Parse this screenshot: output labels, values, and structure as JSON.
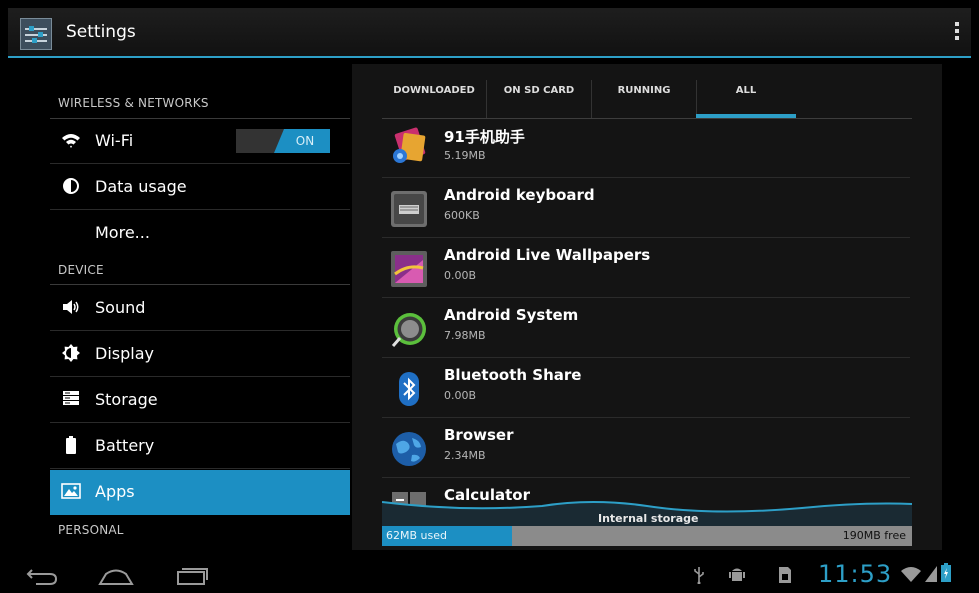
{
  "action_bar": {
    "title": "Settings"
  },
  "left_pane": {
    "sections": {
      "wireless": "WIRELESS & NETWORKS",
      "device": "DEVICE",
      "personal": "PERSONAL"
    },
    "items": [
      {
        "label": "Wi-Fi",
        "icon": "wifi-icon",
        "toggle": "ON"
      },
      {
        "label": "Data usage",
        "icon": "data-usage-icon"
      },
      {
        "label": "More..."
      },
      {
        "label": "Sound",
        "icon": "speaker-icon"
      },
      {
        "label": "Display",
        "icon": "brightness-icon"
      },
      {
        "label": "Storage",
        "icon": "storage-icon"
      },
      {
        "label": "Battery",
        "icon": "battery-icon"
      },
      {
        "label": "Apps",
        "icon": "apps-icon",
        "selected": true
      }
    ]
  },
  "tabs": [
    "DOWNLOADED",
    "ON SD CARD",
    "RUNNING",
    "ALL"
  ],
  "active_tab": "ALL",
  "apps": [
    {
      "name": "91手机助手",
      "size": "5.19MB"
    },
    {
      "name": "Android keyboard",
      "size": "600KB"
    },
    {
      "name": "Android Live Wallpapers",
      "size": "0.00B"
    },
    {
      "name": "Android System",
      "size": "7.98MB"
    },
    {
      "name": "Bluetooth Share",
      "size": "0.00B"
    },
    {
      "name": "Browser",
      "size": "2.34MB"
    },
    {
      "name": "Calculator",
      "size": ""
    }
  ],
  "storage": {
    "label": "Internal storage",
    "used": "62MB used",
    "free": "190MB free"
  },
  "system_bar": {
    "clock": "11:53"
  },
  "colors": {
    "accent": "#2d9fc7",
    "selected": "#1c8fc3"
  }
}
